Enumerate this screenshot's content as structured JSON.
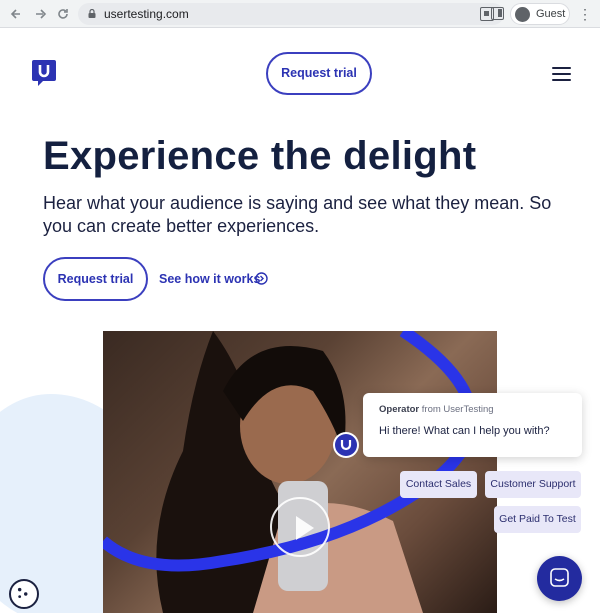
{
  "browser": {
    "url": "usertesting.com",
    "profile_label": "Guest",
    "icons": [
      "back-arrow-icon",
      "forward-arrow-icon",
      "reload-icon",
      "lock-icon",
      "qr-code-icon",
      "side-panel-icon",
      "profile-avatar-icon",
      "more-menu-icon"
    ]
  },
  "header": {
    "logo_icon": "usertesting-logo-icon",
    "cta_label": "Request trial",
    "menu_icon": "hamburger-menu-icon"
  },
  "hero": {
    "title": "Experience the delight",
    "subtitle": "Hear what your audience is saying and see what they mean. So you can create better experiences.",
    "primary_cta": "Request trial",
    "secondary_cta": "See how it works",
    "secondary_icon": "circle-chevron-right-icon"
  },
  "video": {
    "play_icon": "play-icon"
  },
  "chat": {
    "operator": "Operator",
    "from_text": "from UserTesting",
    "message": "Hi there! What can I help you with?",
    "options": [
      "Contact Sales",
      "Customer Support",
      "Get Paid To Test"
    ],
    "launcher_icon": "chat-bubble-icon"
  },
  "cookie": {
    "icon": "cookie-icon"
  },
  "colors": {
    "brand_blue": "#2c33b3",
    "dark_navy": "#142040",
    "chip_bg": "#e8e7f8",
    "launcher_bg": "#232b9f"
  }
}
